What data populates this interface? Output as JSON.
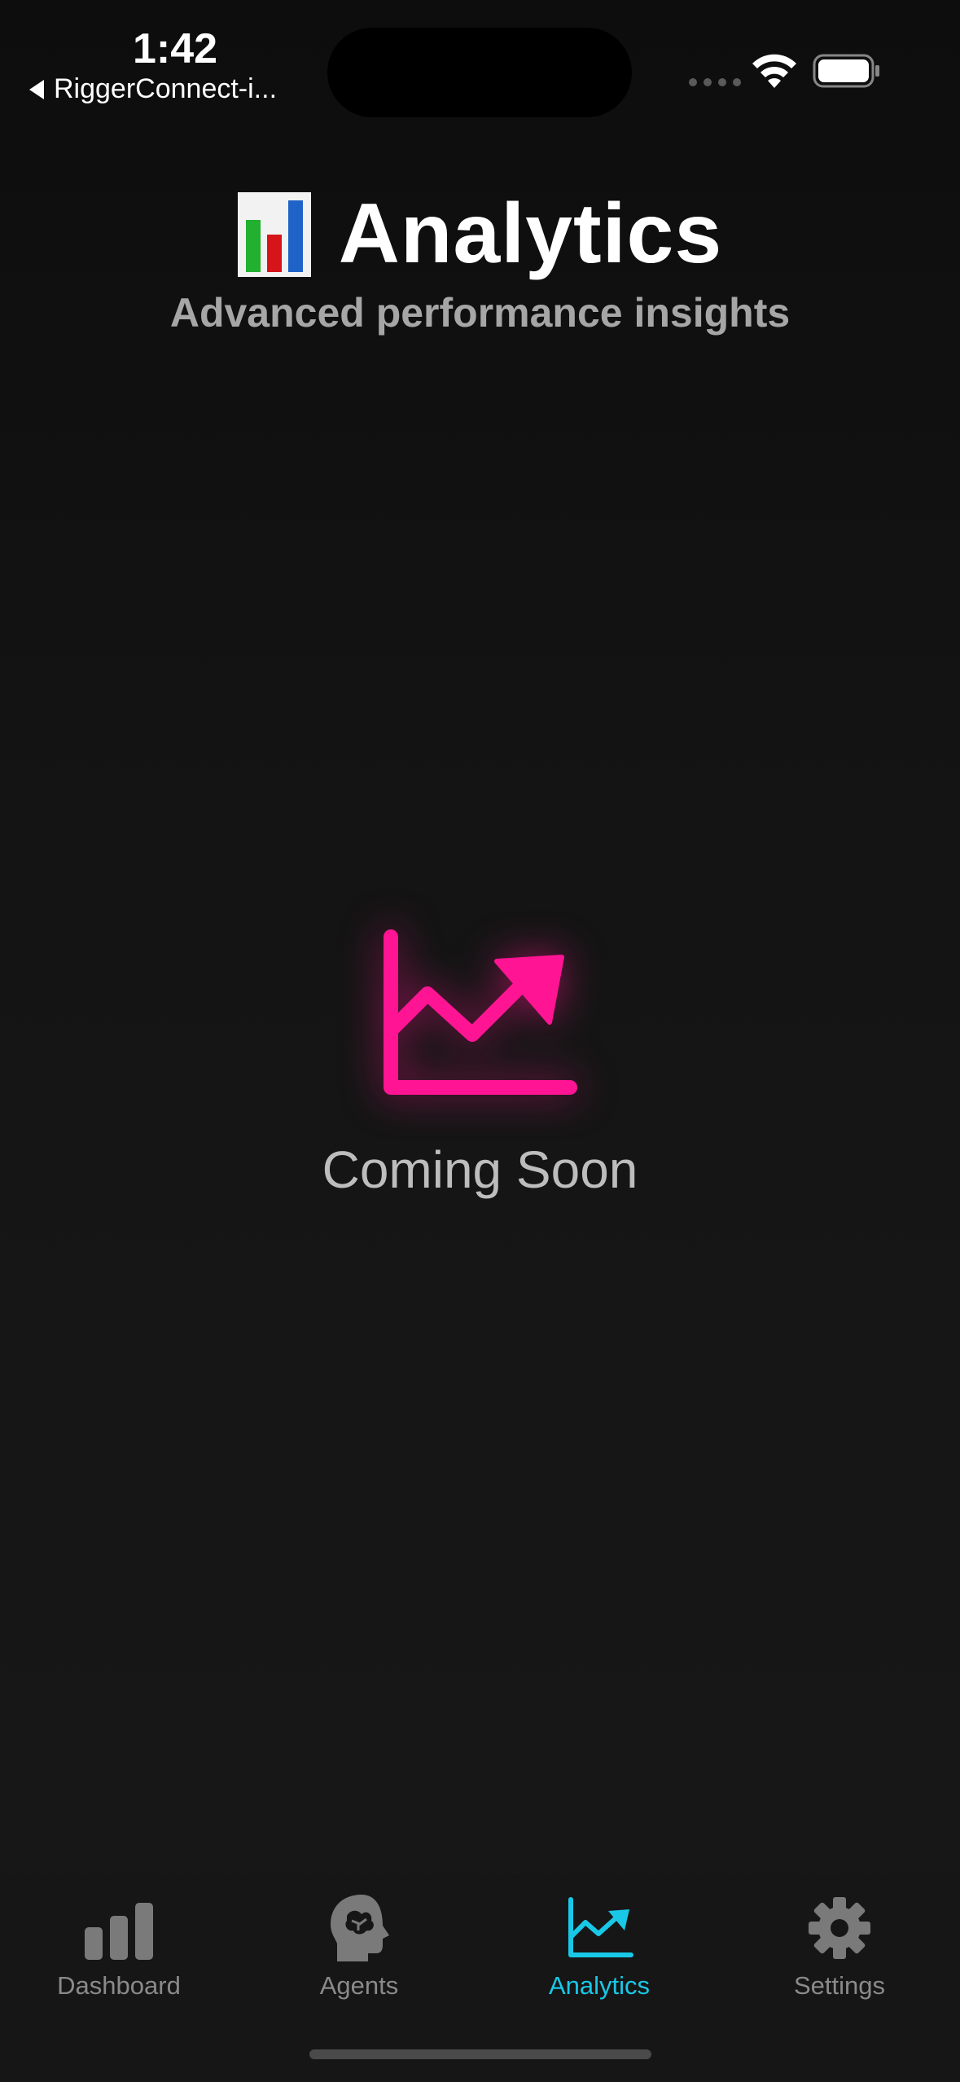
{
  "status_bar": {
    "time": "1:42",
    "back_app": "RiggerConnect-i..."
  },
  "header": {
    "emoji": "📊",
    "title": "Analytics",
    "subtitle": "Advanced performance insights"
  },
  "main": {
    "icon": "chart-line-up-icon",
    "message": "Coming Soon"
  },
  "tab_bar": {
    "tabs": [
      {
        "label": "Dashboard",
        "icon": "bar-chart-icon",
        "active": false
      },
      {
        "label": "Agents",
        "icon": "brain-head-icon",
        "active": false
      },
      {
        "label": "Analytics",
        "icon": "chart-line-up-icon",
        "active": true
      },
      {
        "label": "Settings",
        "icon": "gear-icon",
        "active": false
      }
    ]
  },
  "colors": {
    "accent_active": "#19C8E6",
    "icon_pink": "#FF1493",
    "background": "#111111",
    "inactive": "#8A8A8A"
  }
}
